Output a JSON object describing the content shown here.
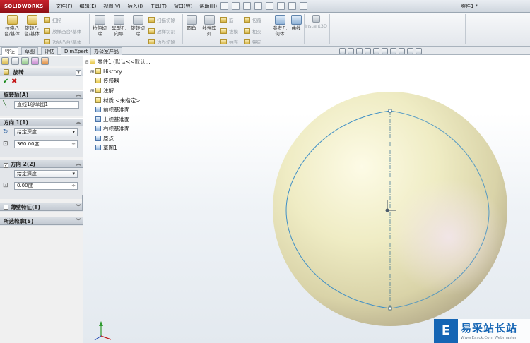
{
  "app": {
    "logo_text": "SOLIDWORKS",
    "document_title": "零件1 *"
  },
  "menu": [
    "文件(F)",
    "编辑(E)",
    "视图(V)",
    "插入(I)",
    "工具(T)",
    "窗口(W)",
    "帮助(H)"
  ],
  "commands": {
    "boss_extrude": "拉伸凸\n台/基体",
    "revolve_boss": "旋转凸\n台/基体",
    "sweep": "扫描",
    "loft": "放样凸台/基体",
    "boundary": "边界凸台/基体",
    "cut_extrude": "拉伸切\n除",
    "hole_wizard": "异型孔\n向导",
    "revolve_cut": "旋转切\n除",
    "swept_cut": "扫描切除",
    "lofted_cut": "放样切割",
    "boundary_cut": "边界切除",
    "fillet": "圆角",
    "linear_pattern": "线性阵\n列",
    "rib": "筋",
    "draft": "拔模",
    "shell": "抽壳",
    "wrap": "包覆",
    "intersect": "相交",
    "mirror": "镜向",
    "ref_geometry": "参考几\n何体",
    "curves": "曲线",
    "instant3d": "Instant3D"
  },
  "tabs": [
    "特征",
    "草图",
    "评估",
    "DimXpert",
    "办公室产品"
  ],
  "property_manager": {
    "feature_title": "旋转",
    "help": "?",
    "ok": "✔",
    "cancel": "✖",
    "axis_section": "旋转轴(A)",
    "axis_value": "直线1@草图1",
    "dir1_section": "方向 1(1)",
    "dir1_type": "给定深度",
    "dir1_angle": "360.00度",
    "dir2_section": "方向 2(2)",
    "dir2_type": "给定深度",
    "dir2_angle": "0.00度",
    "thin_section": "薄壁特征(T)",
    "contours_section": "所选轮廓(S)"
  },
  "tree": {
    "root": "零件1 (默认<<默认...",
    "items": [
      "History",
      "传感器",
      "注解",
      "材质 <未指定>",
      "前视基准面",
      "上视基准面",
      "右视基准面",
      "原点",
      "草图1"
    ]
  },
  "watermark": {
    "logo": "E",
    "name": "易采站长站",
    "url": "Www.Easck.Com  Webmaster"
  },
  "colors": {
    "accent": "#c8232c",
    "sphere": "#efecc4",
    "sketch_line": "#3f8fc6"
  }
}
